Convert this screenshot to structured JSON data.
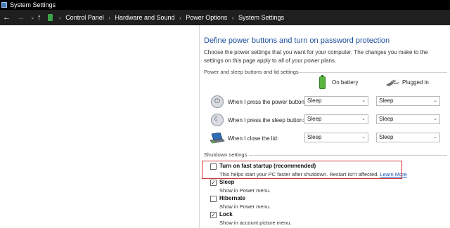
{
  "window": {
    "title": "System Settings"
  },
  "address": {
    "crumbs": [
      "Control Panel",
      "Hardware and Sound",
      "Power Options",
      "System Settings"
    ]
  },
  "main": {
    "heading": "Define power buttons and turn on password protection",
    "intro": "Choose the power settings that you want for your computer. The changes you make to the settings on this page apply to all of your power plans.",
    "power_group_label": "Power and sleep buttons and lid settings",
    "columns": {
      "battery": "On battery",
      "plugged": "Plugged in"
    },
    "rows": [
      {
        "label": "When I press the power button:",
        "battery": "Sleep",
        "plugged": "Sleep",
        "icon": "power-button-icon"
      },
      {
        "label": "When I press the sleep button:",
        "battery": "Sleep",
        "plugged": "Sleep",
        "icon": "sleep-button-icon"
      },
      {
        "label": "When I close the lid:",
        "battery": "Sleep",
        "plugged": "Sleep",
        "icon": "laptop-lid-icon"
      }
    ],
    "shutdown_group_label": "Shutdown settings",
    "shutdown": [
      {
        "label": "Turn on fast startup (recommended)",
        "desc": "This helps start your PC faster after shutdown. Restart isn't affected.",
        "link": "Learn More",
        "checked": false
      },
      {
        "label": "Sleep",
        "desc": "Show in Power menu.",
        "checked": true
      },
      {
        "label": "Hibernate",
        "desc": "Show in Power menu.",
        "checked": false
      },
      {
        "label": "Lock",
        "desc": "Show in account picture menu.",
        "checked": true
      }
    ]
  },
  "colors": {
    "heading": "#1a4e9a",
    "highlight": "#d23a3a",
    "link": "#1a56b8",
    "titlebar": "#000000"
  }
}
